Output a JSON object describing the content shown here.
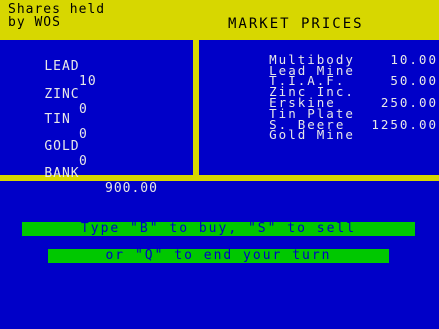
{
  "header": {
    "title_line1": "Shares held",
    "title_line2": "by WOS",
    "market_title": "MARKET PRICES"
  },
  "holdings": [
    {
      "name": "LEAD",
      "quantity": "10"
    },
    {
      "name": "ZINC",
      "quantity": "0"
    },
    {
      "name": "TIN",
      "quantity": "0"
    },
    {
      "name": "GOLD",
      "quantity": "0"
    }
  ],
  "bank": {
    "label": "BANK",
    "value": "900.00"
  },
  "market_prices": [
    {
      "company": "Multibody",
      "price": ""
    },
    {
      "company": "Lead Mine",
      "price": "10.00"
    },
    {
      "company": "T.I.A.F.",
      "price": ""
    },
    {
      "company": "Zinc Inc.",
      "price": "50.00"
    },
    {
      "company": "Erskine",
      "price": ""
    },
    {
      "company": "Tin Plate",
      "price": "250.00"
    },
    {
      "company": "S. Beere",
      "price": ""
    },
    {
      "company": "Gold Mine",
      "price": "1250.00"
    }
  ],
  "prompt": {
    "line1": "Type \"B\" to buy, \"S\" to sell",
    "line2": "or \"Q\" to end your turn"
  },
  "colors": {
    "background": "#0000c8",
    "panel_border": "#d7d700",
    "prompt_bg": "#00c800",
    "text": "#e8e8e8"
  }
}
